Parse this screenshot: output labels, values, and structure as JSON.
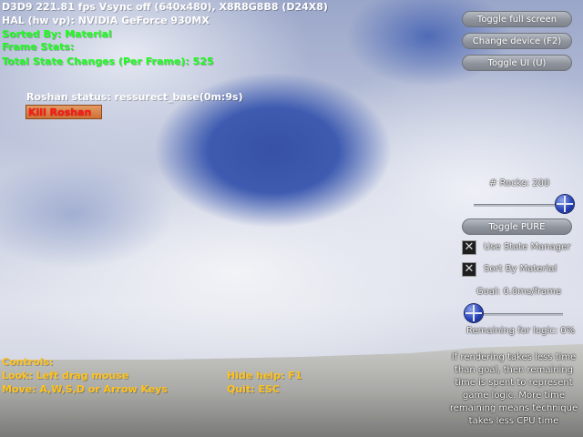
{
  "stats": {
    "line1": "D3D9 221.81 fps Vsync off (640x480), X8R8G8B8 (D24X8)",
    "line2": "HAL (hw vp): NVIDIA GeForce 930MX",
    "sorted_by": "Sorted By: Material",
    "frame_stats": "Frame Stats:",
    "state_changes": "Total State Changes (Per Frame): 525"
  },
  "roshan": {
    "status": "Roshan status: ressurect_base(0m:9s)",
    "kill_button": "Kill Roshan"
  },
  "buttons": {
    "toggle_full_screen": "Toggle full screen",
    "change_device": "Change device (F2)",
    "toggle_ui": "Toggle UI (U)",
    "toggle_pure": "Toggle PURE"
  },
  "rocks": {
    "label": "# Rocks: 200",
    "value_fraction": 1.0
  },
  "options": {
    "use_state_manager": {
      "label": "Use State Manager",
      "checked": true
    },
    "sort_by_material": {
      "label": "Sort By Material",
      "checked": true
    }
  },
  "goal": {
    "label": "Goal: 0.0ms/frame",
    "value_fraction": 0.0
  },
  "remaining": "Remaining for logic: 0%",
  "help": "If rendering takes less time than goal, then remaining time is spent to represent game logic. More time remaining means technique takes less CPU time",
  "controls": {
    "title": "Controls:",
    "look": "Look: Left drag mouse",
    "move": "Move: A,W,S,D or Arrow Keys",
    "hide_help": "Hide help: F1",
    "quit": "Quit: ESC"
  },
  "icons": {
    "checkbox_mark": "x-mark-icon",
    "slider": "slider-knob-icon"
  },
  "colors": {
    "stats_text": "#ffffff",
    "green_text": "#1bff1b",
    "controls_text": "#ffc21a",
    "kill_text": "#ff1a1a"
  }
}
